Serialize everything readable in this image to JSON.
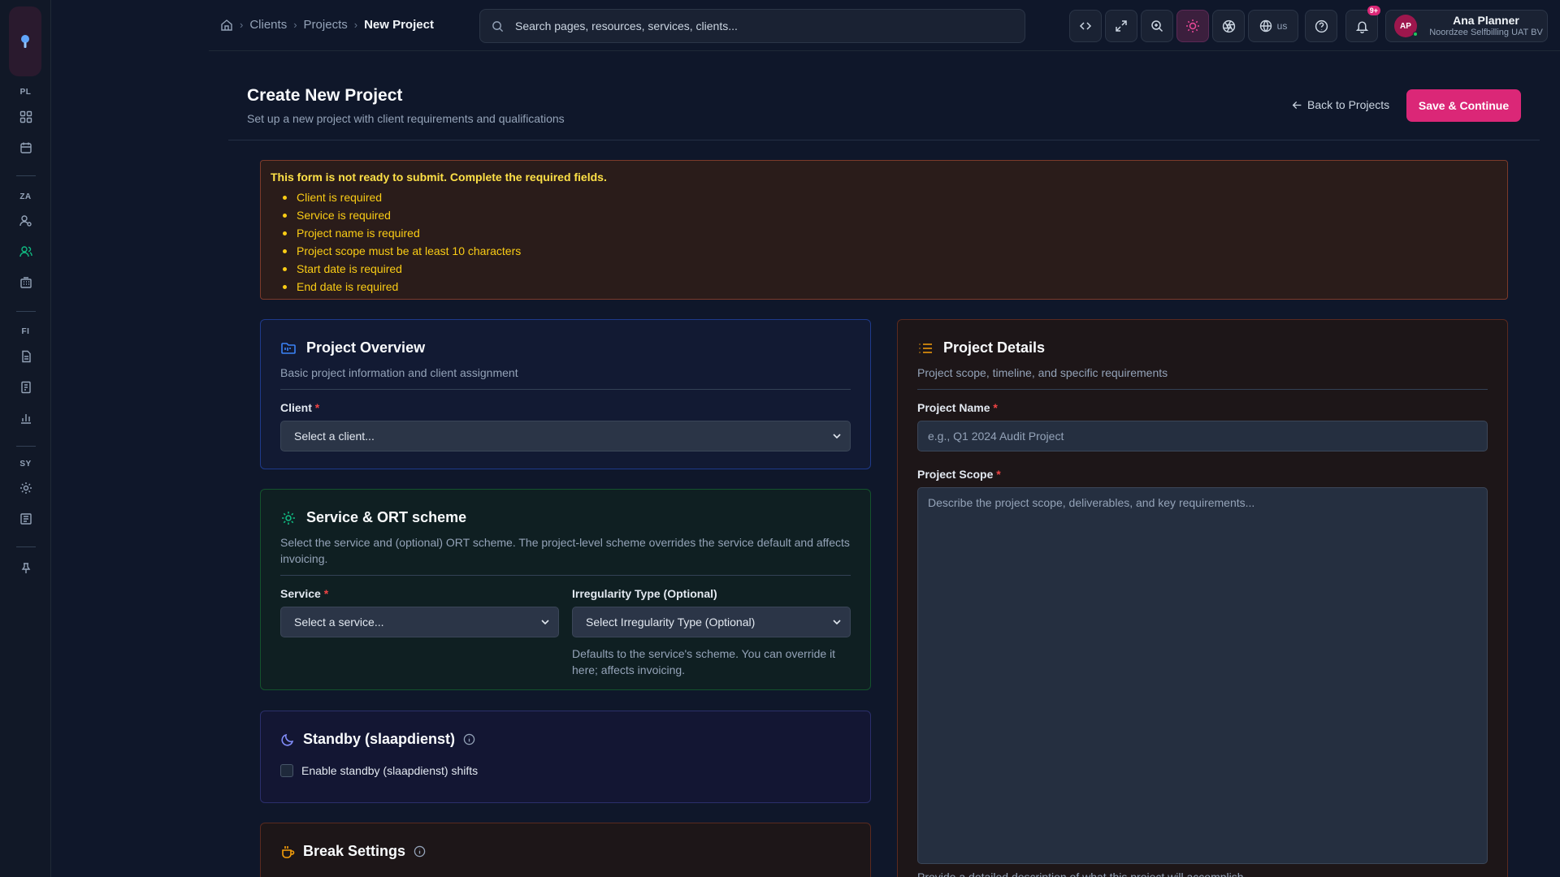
{
  "rail": {
    "sections": [
      "PL",
      "ZA",
      "FI",
      "SY"
    ]
  },
  "breadcrumb": {
    "items": [
      "Clients",
      "Projects"
    ],
    "current": "New Project"
  },
  "search": {
    "placeholder": "Search pages, resources, services, clients..."
  },
  "topbar": {
    "language": "us",
    "notifications_badge": "9+"
  },
  "user": {
    "initials": "AP",
    "name": "Ana Planner",
    "org": "Noordzee Selfbilling UAT BV"
  },
  "header": {
    "title": "Create New Project",
    "subtitle": "Set up a new project with client requirements and qualifications",
    "back_label": "Back to Projects",
    "save_label": "Save & Continue"
  },
  "alert": {
    "title": "This form is not ready to submit. Complete the required fields.",
    "errors": [
      "Client is required",
      "Service is required",
      "Project name is required",
      "Project scope must be at least 10 characters",
      "Start date is required",
      "End date is required"
    ]
  },
  "overview": {
    "title": "Project Overview",
    "description": "Basic project information and client assignment",
    "client_label": "Client",
    "client_value": "Select a client..."
  },
  "service": {
    "title": "Service & ORT scheme",
    "description": "Select the service and (optional) ORT scheme. The project-level scheme overrides the service default and affects invoicing.",
    "service_label": "Service",
    "service_value": "Select a service...",
    "irregularity_label": "Irregularity Type (Optional)",
    "irregularity_value": "Select Irregularity Type (Optional)",
    "irregularity_help": "Defaults to the service's scheme. You can override it here; affects invoicing."
  },
  "standby": {
    "title": "Standby (slaapdienst)",
    "checkbox_label": "Enable standby (slaapdienst) shifts"
  },
  "breaks": {
    "title": "Break Settings"
  },
  "details": {
    "title": "Project Details",
    "description": "Project scope, timeline, and specific requirements",
    "name_label": "Project Name",
    "name_placeholder": "e.g., Q1 2024 Audit Project",
    "scope_label": "Project Scope",
    "scope_placeholder": "Describe the project scope, deliverables, and key requirements...",
    "scope_help": "Provide a detailed description of what this project will accomplish"
  },
  "colors": {
    "accent": "#db2777",
    "warning": "#facc15",
    "success": "#10b981"
  }
}
